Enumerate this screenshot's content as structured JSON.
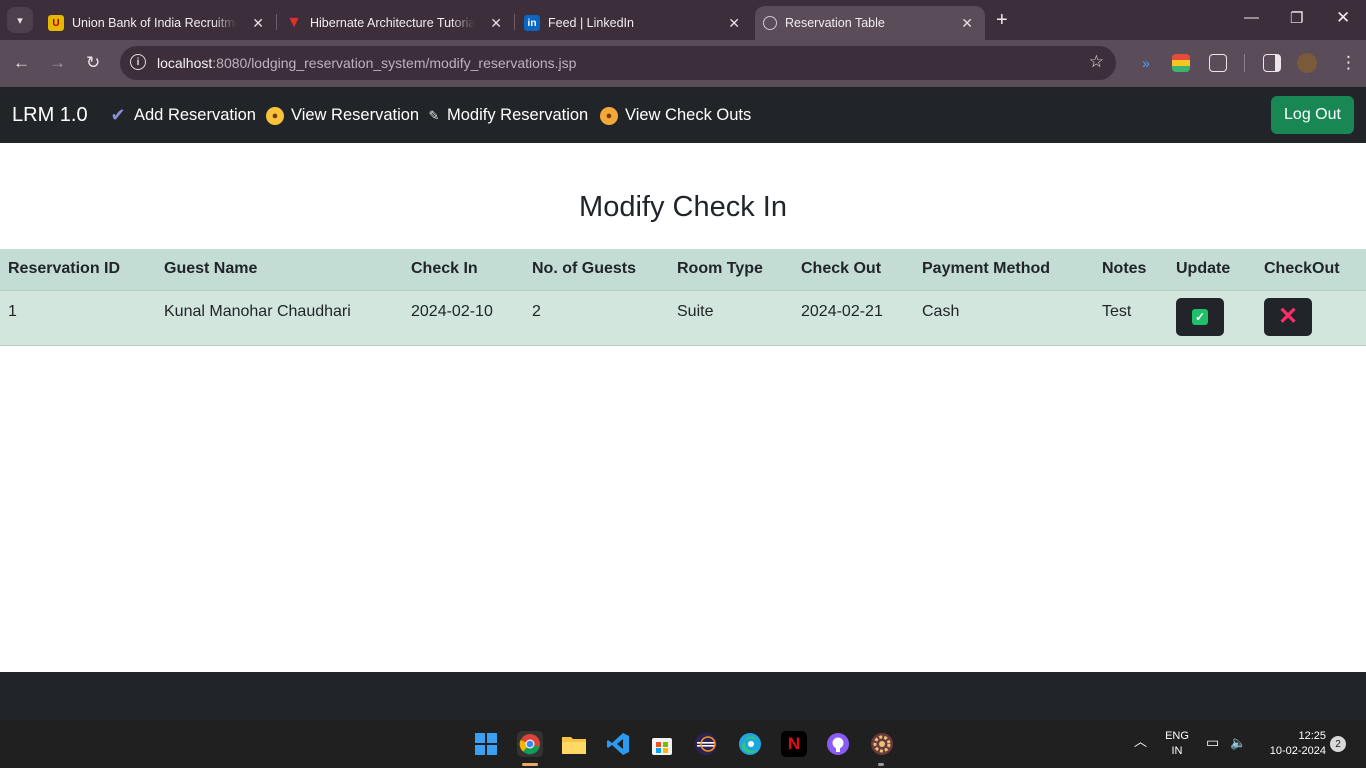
{
  "browser": {
    "tabs": [
      {
        "title": "Union Bank of India Recruitmen",
        "active": false
      },
      {
        "title": "Hibernate Architecture Tutorial",
        "active": false
      },
      {
        "title": "Feed | LinkedIn",
        "active": false
      },
      {
        "title": "Reservation Table",
        "active": true
      }
    ],
    "url_host": "localhost",
    "url_rest": ":8080/lodging_reservation_system/modify_reservations.jsp",
    "favicon_linkedin": "in"
  },
  "navbar": {
    "brand": "LRM 1.0",
    "links": [
      {
        "label": "Add Reservation",
        "icon": "checkmark-icon"
      },
      {
        "label": "View Reservation",
        "icon": "astonished-face-icon"
      },
      {
        "label": "Modify Reservation",
        "icon": "pencil-icon"
      },
      {
        "label": "View Check Outs",
        "icon": "shushing-face-icon"
      }
    ],
    "logout": "Log Out"
  },
  "page": {
    "title": "Modify Check In"
  },
  "table": {
    "headers": [
      "Reservation ID",
      "Guest Name",
      "Check In",
      "No. of Guests",
      "Room Type",
      "Check Out",
      "Payment Method",
      "Notes",
      "Update",
      "CheckOut"
    ],
    "rows": [
      {
        "id": "1",
        "guest": "Kunal Manohar Chaudhari",
        "check_in": "2024-02-10",
        "guests": "2",
        "room": "Suite",
        "check_out": "2024-02-21",
        "payment": "Cash",
        "notes": "Test"
      }
    ]
  },
  "taskbar": {
    "lang": "ENG",
    "region": "IN",
    "time": "12:25",
    "date": "10-02-2024",
    "notifications": "2"
  },
  "colors": {
    "navbar_bg": "#212529",
    "logout_bg": "#198754",
    "table_header_bg": "#c4ddd4",
    "table_row_bg": "#d2e6de",
    "update_icon": "#20c06a",
    "checkout_icon": "#ff2d6a"
  }
}
